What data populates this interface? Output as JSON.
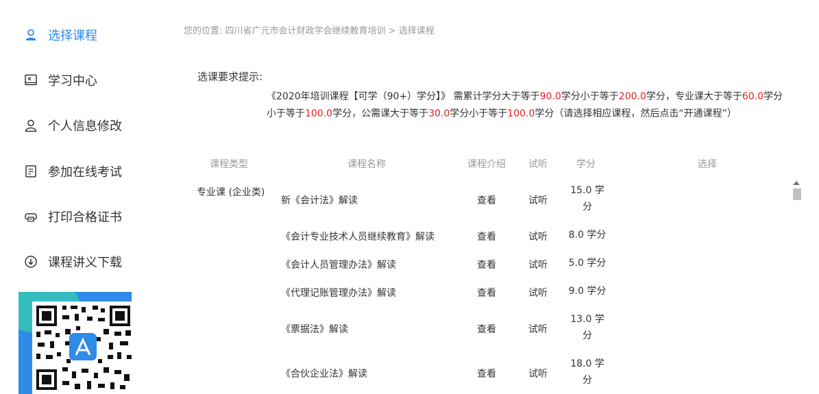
{
  "sidebar": {
    "items": [
      {
        "label": "选择课程",
        "icon": "user-icon",
        "active": true
      },
      {
        "label": "学习中心",
        "icon": "book-icon",
        "active": false
      },
      {
        "label": "个人信息修改",
        "icon": "person-icon",
        "active": false
      },
      {
        "label": "参加在线考试",
        "icon": "exam-icon",
        "active": false
      },
      {
        "label": "打印合格证书",
        "icon": "printer-icon",
        "active": false
      },
      {
        "label": "课程讲义下载",
        "icon": "download-icon",
        "active": false
      }
    ]
  },
  "breadcrumb": {
    "prefix": "您的位置:",
    "site": "四川省广元市会计财政学会继续教育培训",
    "separator": ">",
    "current": "选择课程"
  },
  "hint": {
    "title": "选课要求提示:",
    "p1": "《2020年培训课程【可学（90+）学分】》 需累计学分大于等于",
    "v1": "90.0",
    "p2": "学分小于等于",
    "v2": "200.0",
    "p3": "学分，专业课大于等于",
    "v3": "60.0",
    "p4": "学分",
    "p5": "小于等于",
    "v4": "100.0",
    "p6": "学分，公需课大于等于",
    "v5": "30.0",
    "p7": "学分小于等于",
    "v6": "100.0",
    "p8": "学分（请选择相应课程，然后点击“开通课程”）"
  },
  "table": {
    "headers": {
      "type": "课程类型",
      "name": "课程名称",
      "intro": "课程介绍",
      "trial": "试听",
      "credit": "学分",
      "select": "选择"
    },
    "category": "专业课 (企业类)",
    "rows": [
      {
        "name": "新《会计法》解读",
        "intro": "查看",
        "trial": "试听",
        "credit_a": "15.0 学",
        "credit_b": "分"
      },
      {
        "name": "《会计专业技术人员继续教育》解读",
        "intro": "查看",
        "trial": "试听",
        "credit_a": "8.0 学分",
        "credit_b": ""
      },
      {
        "name": "《会计人员管理办法》解读",
        "intro": "查看",
        "trial": "试听",
        "credit_a": "5.0 学分",
        "credit_b": ""
      },
      {
        "name": "《代理记账管理办法》解读",
        "intro": "查看",
        "trial": "试听",
        "credit_a": "9.0 学分",
        "credit_b": ""
      },
      {
        "name": "《票据法》解读",
        "intro": "查看",
        "trial": "试听",
        "credit_a": "13.0 学",
        "credit_b": "分"
      },
      {
        "name": "《合伙企业法》解读",
        "intro": "查看",
        "trial": "试听",
        "credit_a": "18.0 学",
        "credit_b": "分"
      }
    ]
  },
  "colors": {
    "accent": "#2e8ae6",
    "red": "#e02020",
    "qr_bg": "#2f8ae8"
  }
}
